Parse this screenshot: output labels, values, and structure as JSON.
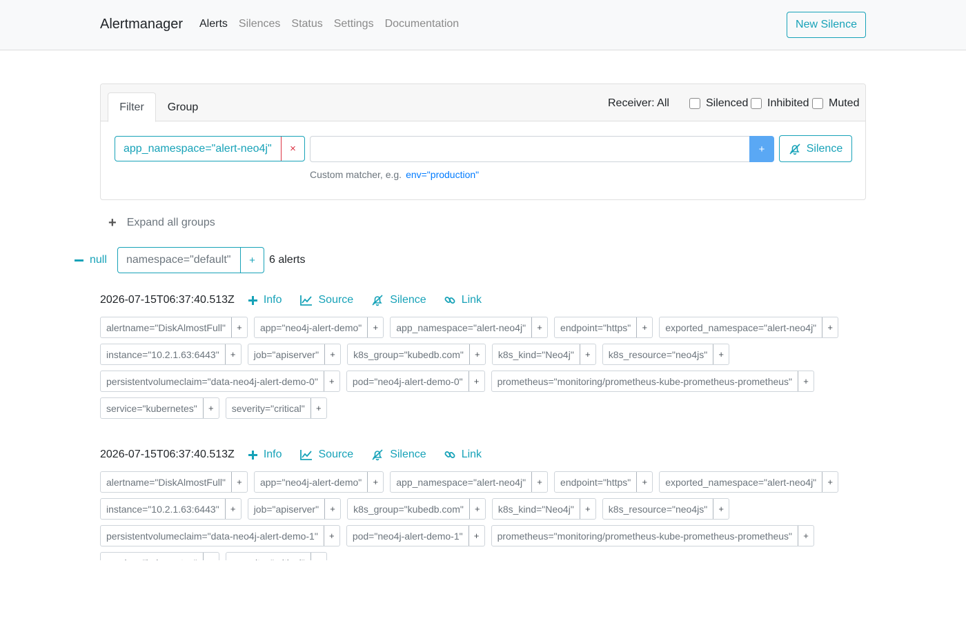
{
  "navbar": {
    "brand": "Alertmanager",
    "links": [
      {
        "label": "Alerts",
        "active": true
      },
      {
        "label": "Silences",
        "active": false
      },
      {
        "label": "Status",
        "active": false
      },
      {
        "label": "Settings",
        "active": false
      },
      {
        "label": "Documentation",
        "active": false
      }
    ],
    "new_silence_label": "New Silence"
  },
  "filter": {
    "tabs": [
      "Filter",
      "Group"
    ],
    "receiver": "Receiver: All",
    "checkboxes": [
      {
        "label": "Silenced",
        "checked": false
      },
      {
        "label": "Inhibited",
        "checked": false
      },
      {
        "label": "Muted",
        "checked": false
      }
    ],
    "active_matcher": "app_namespace=\"alert-neo4j\"",
    "remove_symbol": "×",
    "input_value": "",
    "add_symbol": "+",
    "silence_label": "Silence",
    "hint_text": "Custom matcher, e.g.",
    "hint_example": "env=\"production\""
  },
  "expand_label": "Expand all groups",
  "group": {
    "name": "null",
    "label": "namespace=\"default\"",
    "add_symbol": "+",
    "count": "6 alerts"
  },
  "alert_actions": [
    "Info",
    "Source",
    "Silence",
    "Link"
  ],
  "alerts": [
    {
      "timestamp": "2026-07-15T06:37:40.513Z",
      "labels": [
        "alertname=\"DiskAlmostFull\"",
        "app=\"neo4j-alert-demo\"",
        "app_namespace=\"alert-neo4j\"",
        "endpoint=\"https\"",
        "exported_namespace=\"alert-neo4j\"",
        "instance=\"10.2.1.63:6443\"",
        "job=\"apiserver\"",
        "k8s_group=\"kubedb.com\"",
        "k8s_kind=\"Neo4j\"",
        "k8s_resource=\"neo4js\"",
        "persistentvolumeclaim=\"data-neo4j-alert-demo-0\"",
        "pod=\"neo4j-alert-demo-0\"",
        "prometheus=\"monitoring/prometheus-kube-prometheus-prometheus\"",
        "service=\"kubernetes\"",
        "severity=\"critical\""
      ]
    },
    {
      "timestamp": "2026-07-15T06:37:40.513Z",
      "labels": [
        "alertname=\"DiskAlmostFull\"",
        "app=\"neo4j-alert-demo\"",
        "app_namespace=\"alert-neo4j\"",
        "endpoint=\"https\"",
        "exported_namespace=\"alert-neo4j\"",
        "instance=\"10.2.1.63:6443\"",
        "job=\"apiserver\"",
        "k8s_group=\"kubedb.com\"",
        "k8s_kind=\"Neo4j\"",
        "k8s_resource=\"neo4js\"",
        "persistentvolumeclaim=\"data-neo4j-alert-demo-1\"",
        "pod=\"neo4j-alert-demo-1\"",
        "prometheus=\"monitoring/prometheus-kube-prometheus-prometheus\"",
        "service=\"kubernetes\"",
        "severity=\"critical\""
      ]
    }
  ],
  "label_add_symbol": "+",
  "colors": {
    "accent": "#17a2b8",
    "danger": "#dc3545",
    "primary_button": "#5aa8f4",
    "link": "#007bff"
  }
}
